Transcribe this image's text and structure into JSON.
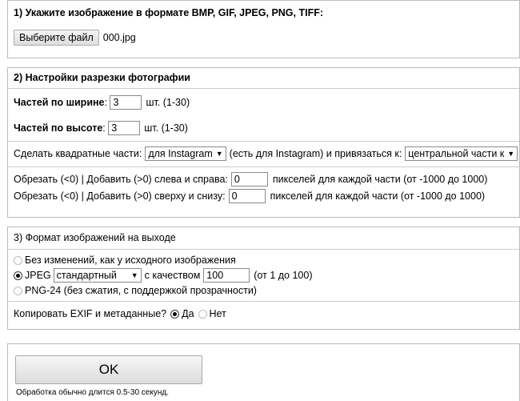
{
  "section1": {
    "title": "1) Укажите изображение в формате BMP, GIF, JPEG, PNG, TIFF:",
    "choose_file_label": "Выберите файл",
    "file_name": "000.jpg"
  },
  "section2": {
    "title": "2) Настройки разрезки фотографии",
    "width_label": "Частей по ширине",
    "width_value": "3",
    "width_hint": "шт. (1-30)",
    "height_label": "Частей по высоте",
    "height_value": "3",
    "height_hint": "шт. (1-30)",
    "square_label": "Сделать квадратные части:",
    "square_select": "для Instagram",
    "square_middle": "(есть для Instagram) и привязаться к:",
    "anchor_select": "центральной части к",
    "crop_lr_label": "Обрезать (<0) | Добавить (>0) слева и справа:",
    "crop_lr_value": "0",
    "crop_lr_hint": "пикселей для каждой части (от -1000 до 1000)",
    "crop_tb_label": "Обрезать (<0) | Добавить (>0) сверху и снизу:",
    "crop_tb_value": "0",
    "crop_tb_hint": "пикселей для каждой части (от -1000 до 1000)"
  },
  "section3": {
    "title": "3) Формат изображений на выходе",
    "opt_original": "Без изменений, как у исходного изображения",
    "opt_jpeg": "JPEG",
    "jpeg_select": "стандартный",
    "quality_label": "с качеством",
    "quality_value": "100",
    "quality_hint": "(от 1 до 100)",
    "opt_png": "PNG-24 (без сжатия, с поддержкой прозрачности)",
    "exif_label": "Копировать EXIF и метаданные?",
    "exif_yes": "Да",
    "exif_no": "Нет"
  },
  "submit": {
    "ok_label": "OK",
    "note": "Обработка обычно длится 0.5-30 секунд."
  }
}
